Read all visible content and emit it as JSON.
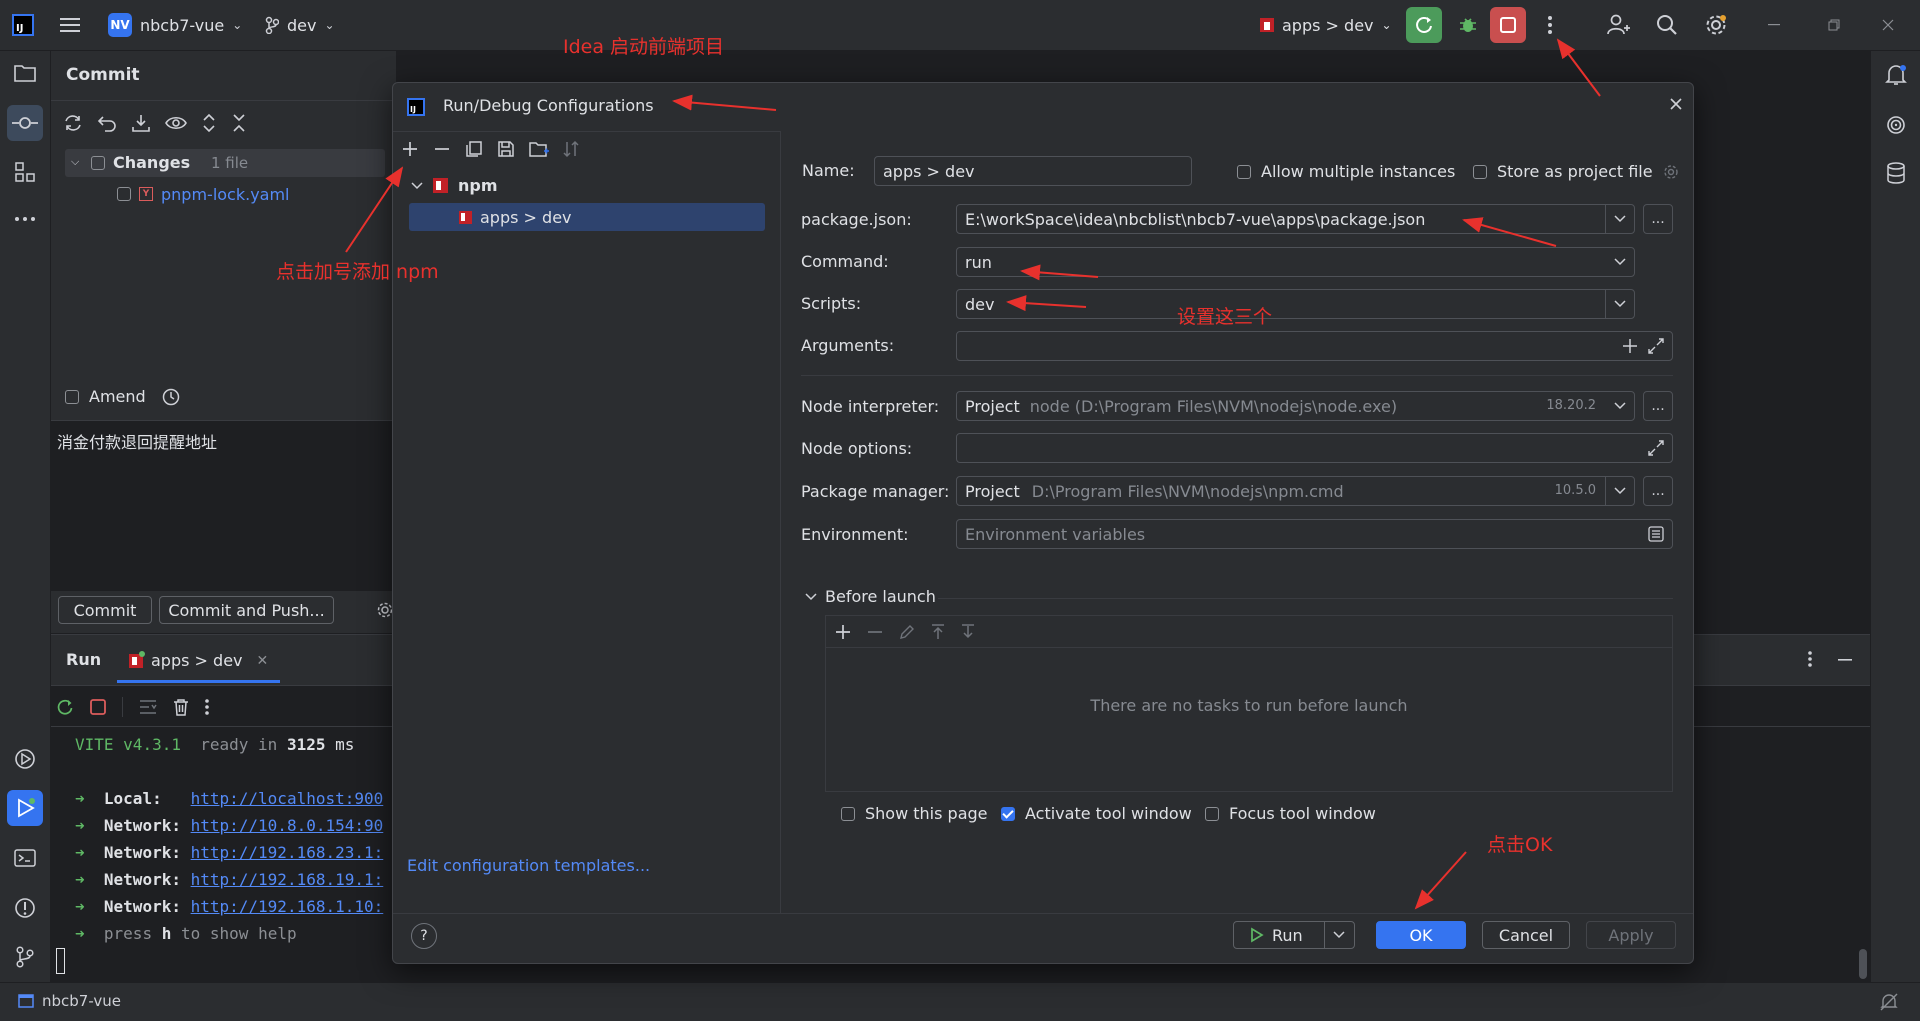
{
  "titlebar": {
    "project_badge": "NV",
    "project_name": "nbcb7-vue",
    "branch": "dev",
    "run_config": "apps > dev"
  },
  "commit_panel": {
    "title": "Commit",
    "changes_label": "Changes",
    "changes_count": "1 file",
    "file_name": "pnpm-lock.yaml",
    "amend_label": "Amend",
    "commit_message": "消金付款退回提醒地址",
    "commit_button": "Commit",
    "commit_push_button": "Commit and Push..."
  },
  "run_window": {
    "title": "Run",
    "tab_label": "apps > dev",
    "console": {
      "vite_name": "VITE",
      "vite_version": "v4.3.1",
      "ready_text": "ready in",
      "ready_ms": "3125",
      "ms_unit": "ms",
      "lines": [
        {
          "label": "Local:  ",
          "url": "http://localhost:900"
        },
        {
          "label": "Network:",
          "url": "http://10.8.0.154:90"
        },
        {
          "label": "Network:",
          "url": "http://192.168.23.1:"
        },
        {
          "label": "Network:",
          "url": "http://192.168.19.1:"
        },
        {
          "label": "Network:",
          "url": "http://192.168.1.10:"
        }
      ],
      "help_pre": "press",
      "help_key": "h",
      "help_post": "to show help"
    }
  },
  "statusbar": {
    "project": "nbcb7-vue"
  },
  "dialog": {
    "title": "Run/Debug Configurations",
    "tree_root": "npm",
    "tree_child": "apps > dev",
    "edit_templates_link": "Edit configuration templates...",
    "name_label": "Name:",
    "name_value": "apps > dev",
    "allow_multiple": "Allow multiple instances",
    "store_as_project": "Store as project file",
    "package_json_label": "package.json:",
    "package_json_value": "E:\\workSpace\\idea\\nbcblist\\nbcb7-vue\\apps\\package.json",
    "command_label": "Command:",
    "command_value": "run",
    "scripts_label": "Scripts:",
    "scripts_value": "dev",
    "arguments_label": "Arguments:",
    "node_interpreter_label": "Node interpreter:",
    "node_interpreter_prefix": "Project",
    "node_interpreter_path": "node (D:\\Program Files\\NVM\\nodejs\\node.exe)",
    "node_interpreter_version": "18.20.2",
    "node_options_label": "Node options:",
    "package_manager_label": "Package manager:",
    "package_manager_prefix": "Project",
    "package_manager_path": "D:\\Program Files\\NVM\\nodejs\\npm.cmd",
    "package_manager_version": "10.5.0",
    "environment_label": "Environment:",
    "environment_placeholder": "Environment variables",
    "before_launch_label": "Before launch",
    "no_tasks_text": "There are no tasks to run before launch",
    "show_this_page": "Show this page",
    "activate_tool_window": "Activate tool window",
    "focus_tool_window": "Focus tool window",
    "run_button": "Run",
    "ok_button": "OK",
    "cancel_button": "Cancel",
    "apply_button": "Apply",
    "help_button": "?",
    "more_button": "..."
  },
  "annotations": {
    "top": "Idea 启动前端项目",
    "add_npm": "点击加号添加 npm",
    "set_three": "设置这三个",
    "click_ok": "点击OK"
  },
  "colors": {
    "accent": "#3574f0",
    "annotation": "#e8312d",
    "background": "#1e1f22",
    "panel": "#2b2d30"
  }
}
